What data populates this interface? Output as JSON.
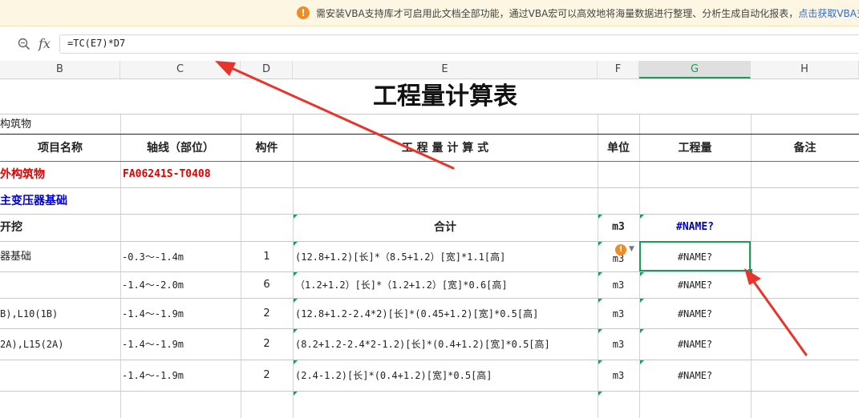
{
  "notice": {
    "icon": "warning-icon",
    "message": "需安装VBA支持库才可启用此文档全部功能，通过VBA宏可以高效地将海量数据进行整理、分析生成自动化报表，",
    "link": "点击获取VBA支"
  },
  "formula_bar": {
    "zoom_icon": "zoom-icon",
    "fx_label": "fx",
    "formula": "=TC(E7)*D7"
  },
  "columns": [
    {
      "id": "B",
      "label": "B"
    },
    {
      "id": "C",
      "label": "C"
    },
    {
      "id": "D",
      "label": "D"
    },
    {
      "id": "E",
      "label": "E"
    },
    {
      "id": "F",
      "label": "F"
    },
    {
      "id": "G",
      "label": "G",
      "selected": true
    },
    {
      "id": "H",
      "label": "H"
    }
  ],
  "sheet": {
    "title": "工程量计算表",
    "subtitle": "构筑物",
    "headers": {
      "item_name": "项目名称",
      "axis": "轴线（部位）",
      "component": "构件",
      "formula": "工 程 量 计 算 式",
      "unit": "单位",
      "quantity": "工程量",
      "remark": "备注"
    },
    "rows": [
      {
        "name": "外构筑物",
        "axis": "FA06241S-T0408",
        "component": "",
        "formula": "",
        "unit": "",
        "quantity": "",
        "style": "red"
      },
      {
        "name": "主变压器基础",
        "axis": "",
        "component": "",
        "formula": "",
        "unit": "",
        "quantity": "",
        "style": "blue"
      },
      {
        "name": "开挖",
        "axis": "",
        "component": "",
        "formula": "合计",
        "unit": "m3",
        "quantity": "#NAME?",
        "style": "total"
      },
      {
        "name": "器基础",
        "axis": "-0.3～-1.4m",
        "component": "1",
        "formula": "(12.8+1.2)[长]*（8.5+1.2）[宽]*1.1[高]",
        "unit": "m3",
        "quantity": "#NAME?",
        "style": "normal"
      },
      {
        "name": "",
        "axis": "-1.4～-2.0m",
        "component": "6",
        "formula": "（1.2+1.2）[长]*（1.2+1.2）[宽]*0.6[高]",
        "unit": "m3",
        "quantity": "#NAME?",
        "style": "normal"
      },
      {
        "name": "B),L10(1B)",
        "axis": "-1.4～-1.9m",
        "component": "2",
        "formula": "(12.8+1.2-2.4*2)[长]*(0.45+1.2)[宽]*0.5[高]",
        "unit": "m3",
        "quantity": "#NAME?",
        "style": "normal"
      },
      {
        "name": "2A),L15(2A)",
        "axis": "-1.4～-1.9m",
        "component": "2",
        "formula": "(8.2+1.2-2.4*2-1.2)[长]*(0.4+1.2)[宽]*0.5[高]",
        "unit": "m3",
        "quantity": "#NAME?",
        "style": "normal"
      },
      {
        "name": "",
        "axis": "-1.4～-1.9m",
        "component": "2",
        "formula": "(2.4-1.2)[长]*(0.4+1.2)[宽]*0.5[高]",
        "unit": "m3",
        "quantity": "#NAME?",
        "style": "normal"
      }
    ]
  },
  "colors": {
    "accent": "#1e9b5c",
    "annotation_arrow": "#e8342b",
    "error_red": "#e00000",
    "blue_text": "#0000cc"
  }
}
